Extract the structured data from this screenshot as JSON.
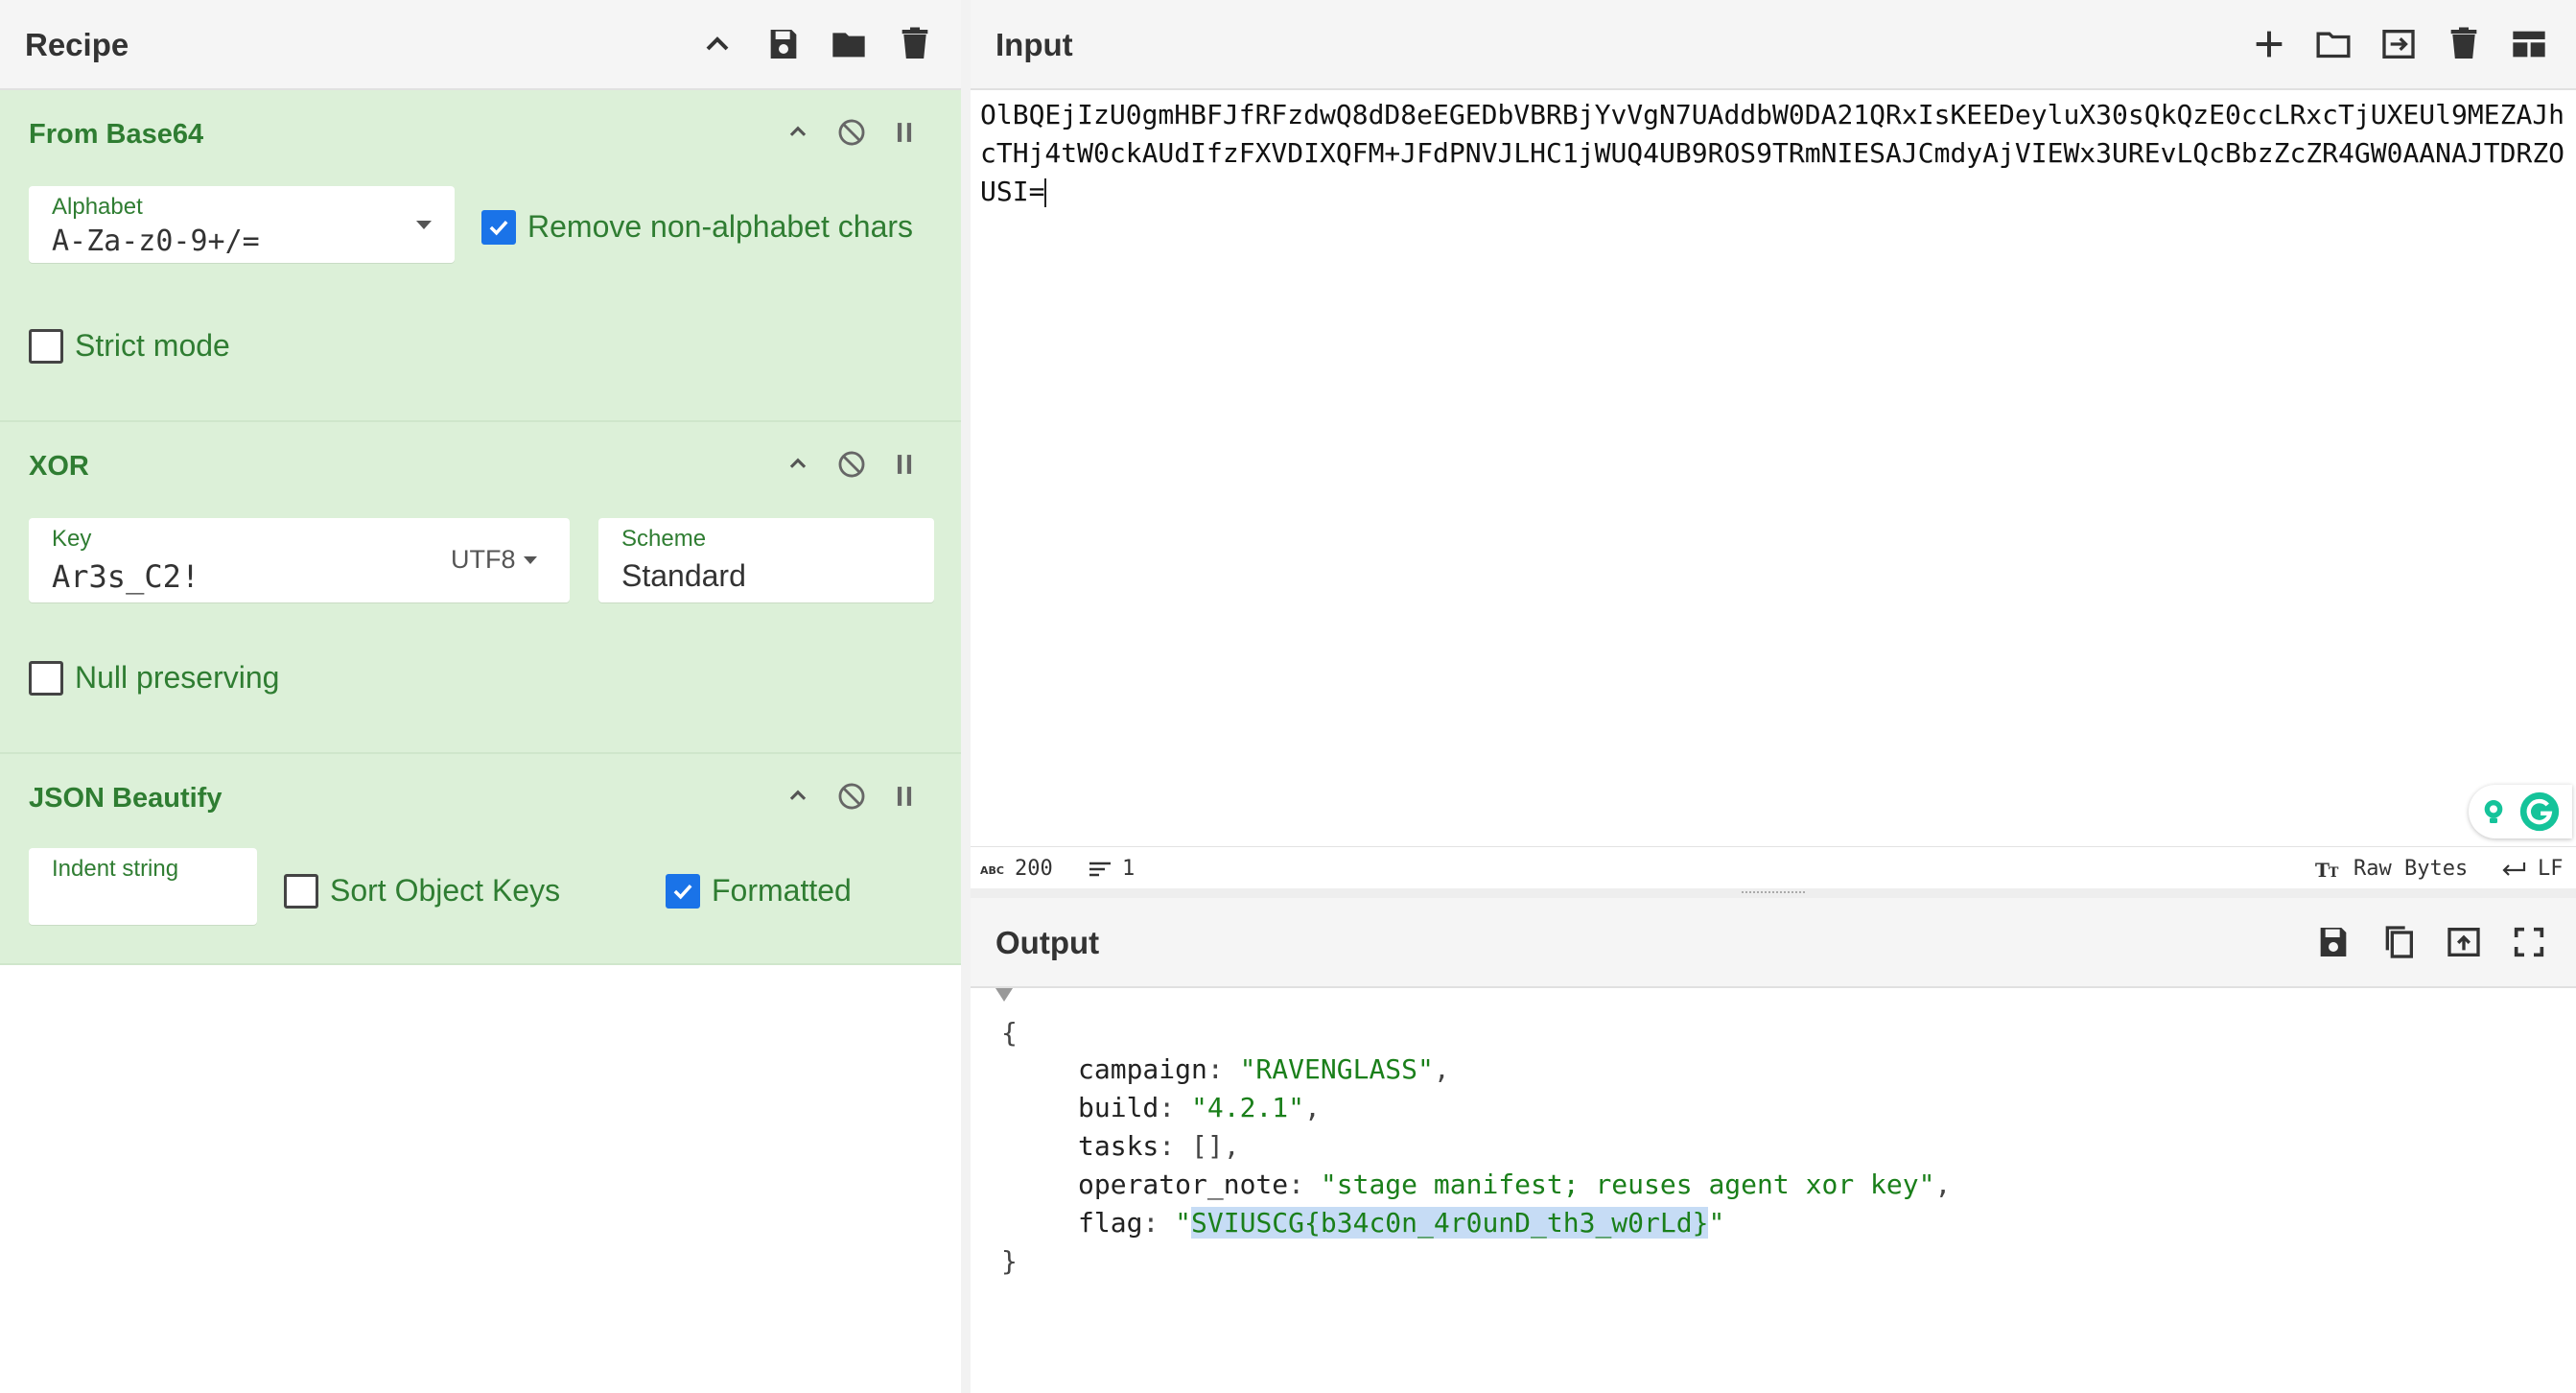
{
  "recipe": {
    "title": "Recipe",
    "operations": [
      {
        "name": "From Base64",
        "alphabet_label": "Alphabet",
        "alphabet_value": "A-Za-z0-9+/=",
        "remove_non_alphabet_label": "Remove non-alphabet chars",
        "remove_non_alphabet_checked": true,
        "strict_mode_label": "Strict mode",
        "strict_mode_checked": false
      },
      {
        "name": "XOR",
        "key_label": "Key",
        "key_value": "Ar3s_C2!",
        "key_encoding": "UTF8",
        "scheme_label": "Scheme",
        "scheme_value": "Standard",
        "null_preserving_label": "Null preserving",
        "null_preserving_checked": false
      },
      {
        "name": "JSON Beautify",
        "indent_label": "Indent string",
        "indent_value": "",
        "sort_keys_label": "Sort Object Keys",
        "sort_keys_checked": false,
        "formatted_label": "Formatted",
        "formatted_checked": true
      }
    ]
  },
  "input": {
    "title": "Input",
    "text": "OlBQEjIzU0gmHBFJfRFzdwQ8dD8eEGEDbVBRBjYvVgN7UAddbW0DA21QRxIsKEEDeyluX30sQkQzE0ccLRxcTjUXEUl9MEZAJhcTHj4tW0ckAUdIfzFXVDIXQFM+JFdPNVJLHC1jWUQ4UB9ROS9TRmNIESAJCmdyAjVIEWx3UREvLQcBbzZcZR4GW0AANAJTDRZOUSI=",
    "status": {
      "char_count": "200",
      "line_count": "1",
      "encoding": "Raw Bytes",
      "line_ending": "LF"
    }
  },
  "output": {
    "title": "Output",
    "open_brace": "{",
    "close_brace": "}",
    "fields": [
      {
        "key": "campaign",
        "value": "\"RAVENGLASS\"",
        "trail": ","
      },
      {
        "key": "build",
        "value": "\"4.2.1\"",
        "trail": ","
      },
      {
        "key": "tasks",
        "value": "[]",
        "trail": ","
      },
      {
        "key": "operator_note",
        "value": "\"stage manifest; reuses agent xor key\"",
        "trail": ","
      }
    ],
    "flag": {
      "key": "flag",
      "quote_open": "\"",
      "value": "SVIUSCG{b34c0n_4r0unD_th3_w0rLd}",
      "quote_close": "\""
    }
  },
  "colors": {
    "operation_bg": "#dcf0d8",
    "operation_text": "#2f7d32",
    "checkbox_checked": "#1a73e8",
    "json_string": "#1a7f1a",
    "selection": "#c6dcf5"
  },
  "icons": {
    "recipe_header": [
      "chevron-up-icon",
      "save-icon",
      "folder-icon",
      "trash-icon"
    ],
    "operation_controls": [
      "chevron-up-icon",
      "disable-icon",
      "pause-icon"
    ],
    "input_header": [
      "plus-icon",
      "folder-icon",
      "import-icon",
      "trash-icon",
      "layout-icon"
    ],
    "output_header": [
      "save-icon",
      "copy-icon",
      "replace-input-icon",
      "fullscreen-icon"
    ]
  }
}
